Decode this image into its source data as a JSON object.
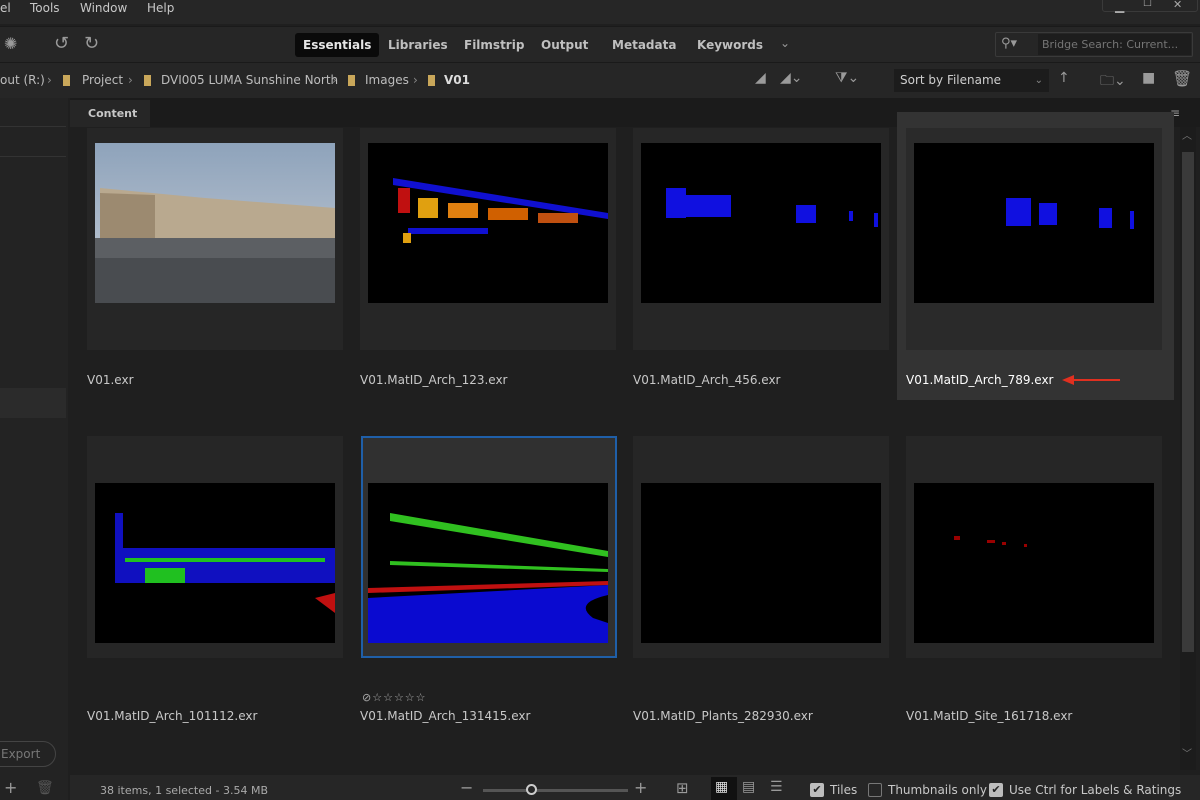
{
  "menu": [
    "el",
    "Tools",
    "Window",
    "Help"
  ],
  "workspaces": [
    {
      "label": "Essentials",
      "active": true
    },
    {
      "label": "Libraries"
    },
    {
      "label": "Filmstrip"
    },
    {
      "label": "Output"
    },
    {
      "label": "Metadata"
    },
    {
      "label": "Keywords"
    }
  ],
  "search": {
    "placeholder": "Bridge Search: Current..."
  },
  "breadcrumb": [
    "out (R:)",
    "Project",
    "DVI005 LUMA Sunshine North",
    "Images",
    "V01"
  ],
  "sort": {
    "value": "Sort by Filename"
  },
  "content_tab": "Content",
  "left_panel": {
    "export_label": "Export"
  },
  "files": [
    {
      "name": "V01.exr",
      "thumb": "photo"
    },
    {
      "name": "V01.MatID_Arch_123.exr",
      "thumb": "arch123"
    },
    {
      "name": "V01.MatID_Arch_456.exr",
      "thumb": "arch456"
    },
    {
      "name": "V01.MatID_Arch_789.exr",
      "thumb": "arch789",
      "highlighted": true,
      "annotation": "red-arrow"
    },
    {
      "name": "V01.MatID_Arch_101112.exr",
      "thumb": "arch101112"
    },
    {
      "name": "V01.MatID_Arch_131415.exr",
      "thumb": "arch131415",
      "selected": true,
      "rating": 0
    },
    {
      "name": "V01.MatID_Plants_282930.exr",
      "thumb": "black"
    },
    {
      "name": "V01.MatID_Site_161718.exr",
      "thumb": "site"
    }
  ],
  "status": {
    "text": "38 items, 1 selected - 3.54 MB",
    "zoom_fraction": 0.33
  },
  "options": [
    {
      "label": "Tiles",
      "checked": true
    },
    {
      "label": "Thumbnails only",
      "checked": false
    },
    {
      "label": "Use Ctrl for Labels & Ratings",
      "checked": true
    }
  ],
  "colors": {
    "accent": "#1f5fa8",
    "folder": "#c9a75a",
    "arrow": "#e03020"
  }
}
